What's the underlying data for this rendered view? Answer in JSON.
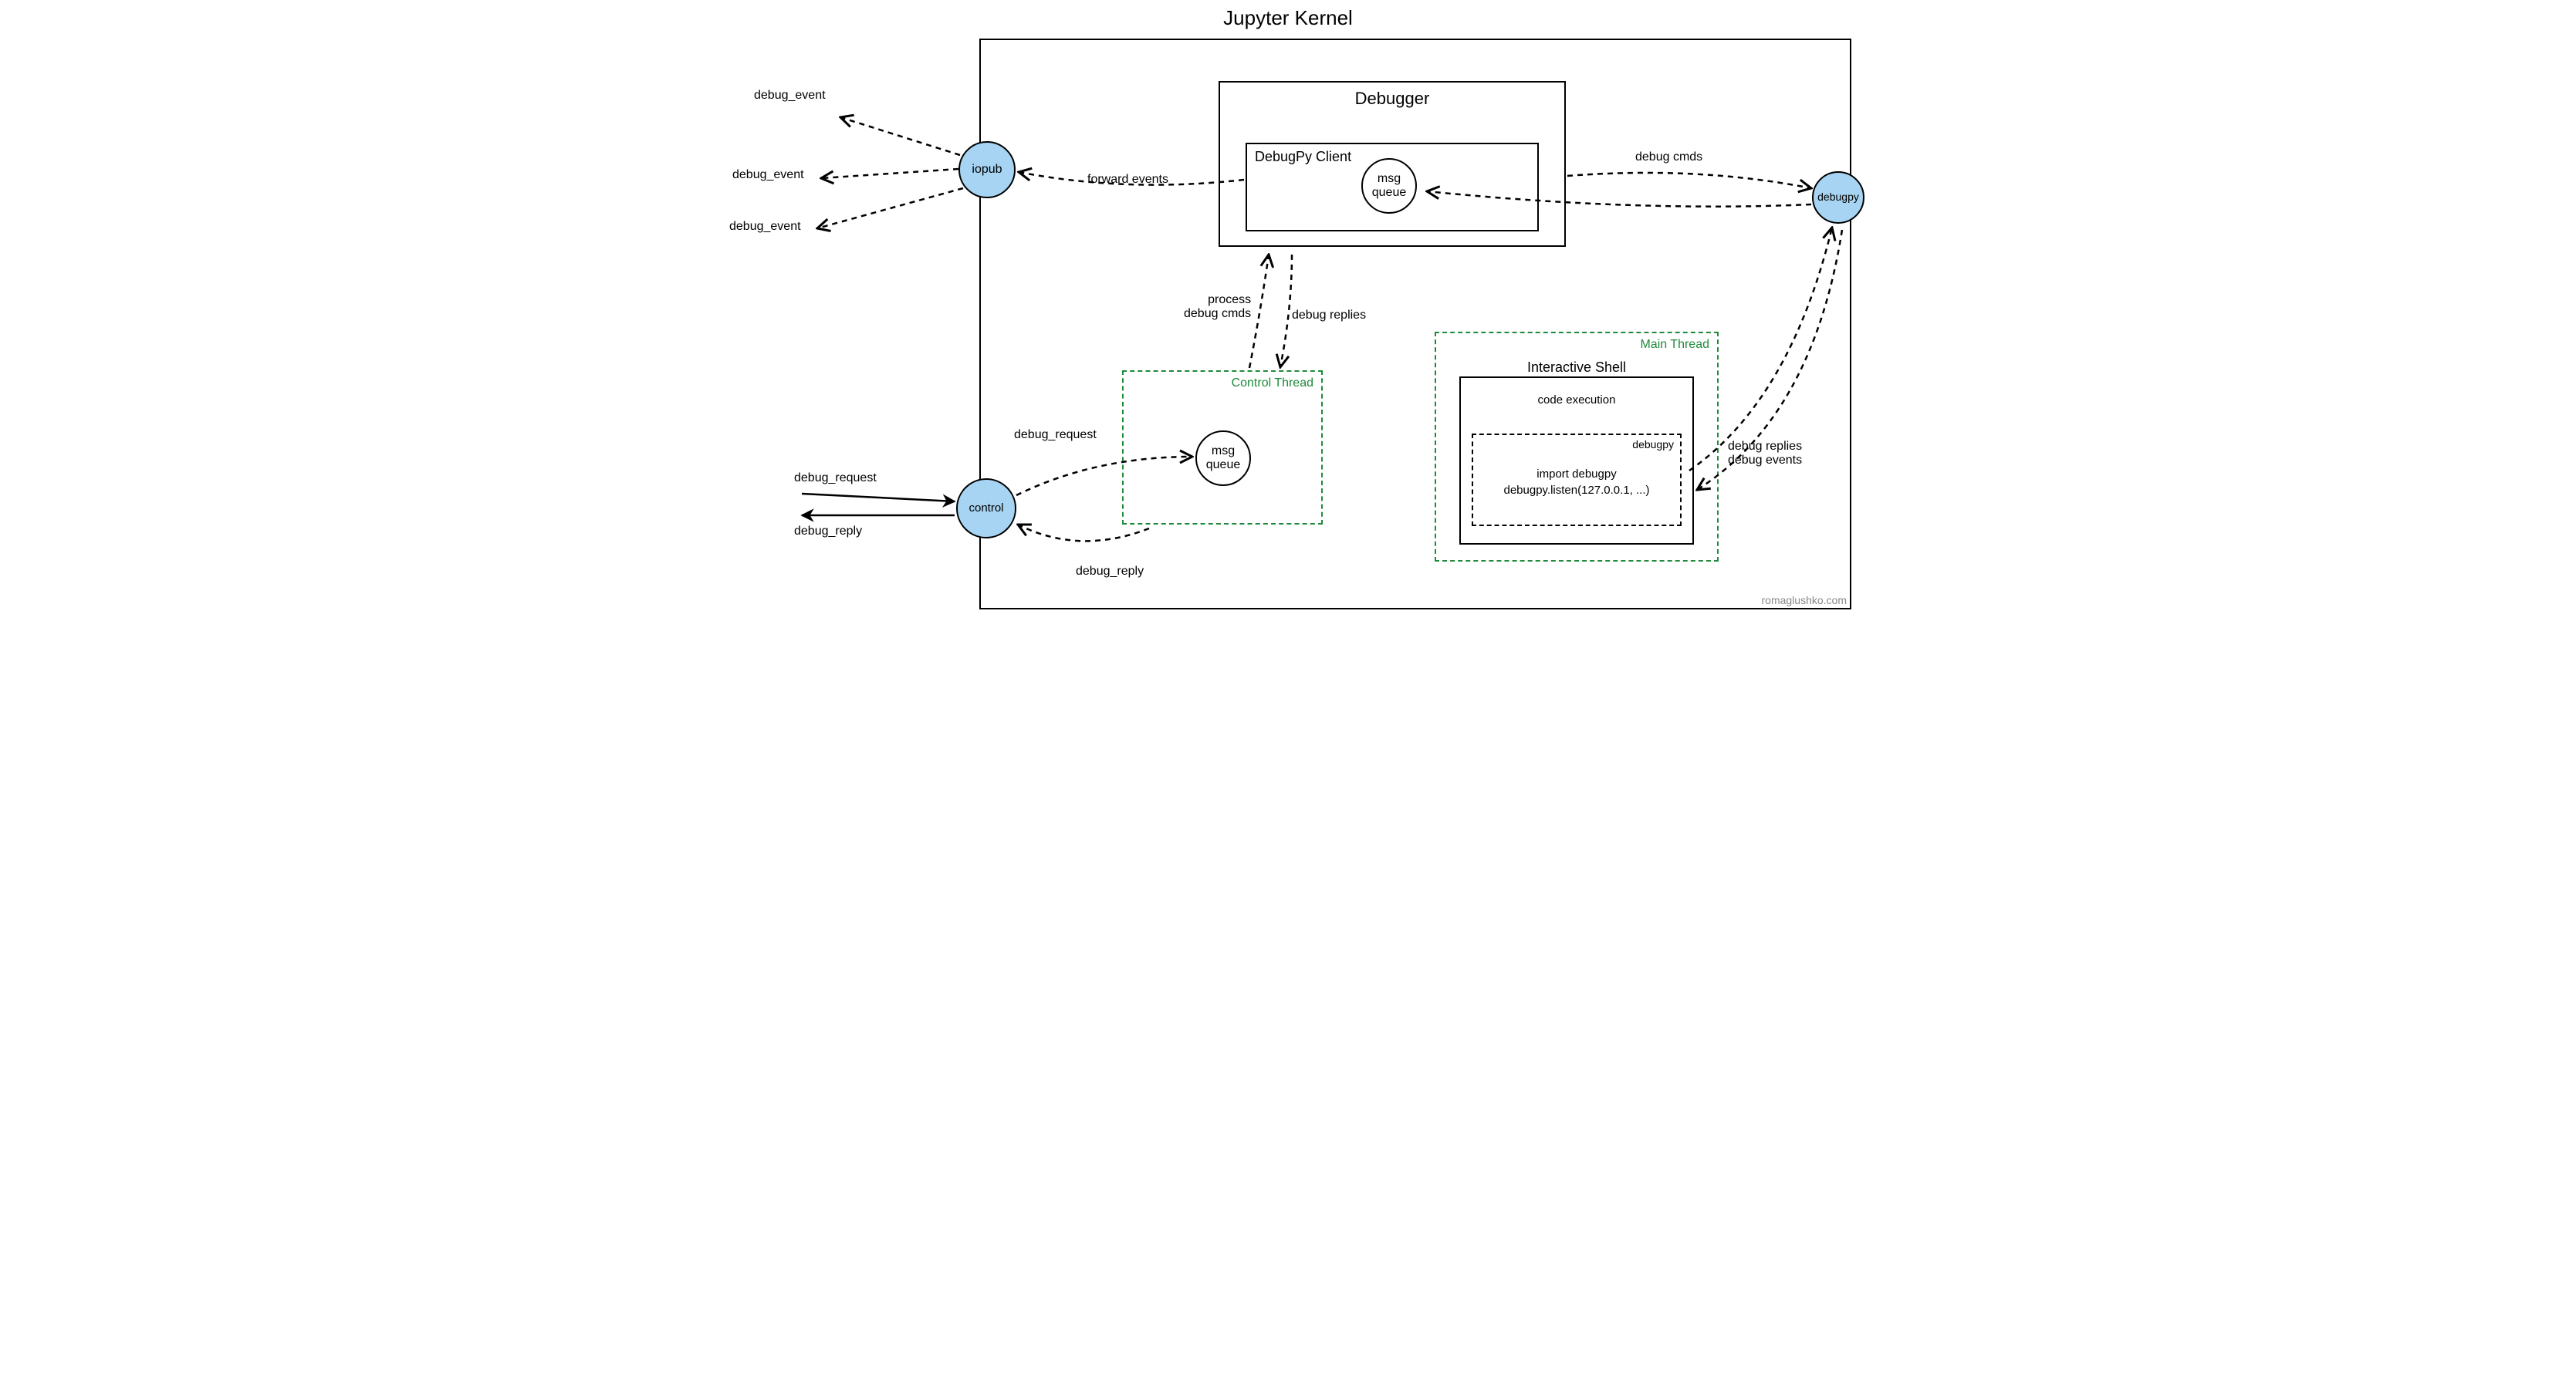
{
  "title": "Jupyter Kernel",
  "nodes": {
    "iopub": "iopub",
    "control": "control",
    "debugpy": "debugpy",
    "debugger": "Debugger",
    "debugpy_client": "DebugPy Client",
    "msg_queue": "msg\nqueue",
    "control_thread": "Control Thread",
    "main_thread": "Main Thread",
    "interactive_shell": "Interactive Shell",
    "code_execution": "code execution",
    "debugpy_inner": "debugpy"
  },
  "code": {
    "line1": "import debugpy",
    "line2": "debugpy.listen(127.0.0.1, ...)"
  },
  "edges": {
    "debug_event": "debug_event",
    "forward_events": "forward events",
    "debug_cmds": "debug cmds",
    "process_debug_cmds": "process\ndebug cmds",
    "debug_replies": "debug replies",
    "debug_request": "debug_request",
    "debug_reply": "debug_reply",
    "debug_replies_events": "debug replies\ndebug events"
  },
  "attribution": "romaglushko.com"
}
